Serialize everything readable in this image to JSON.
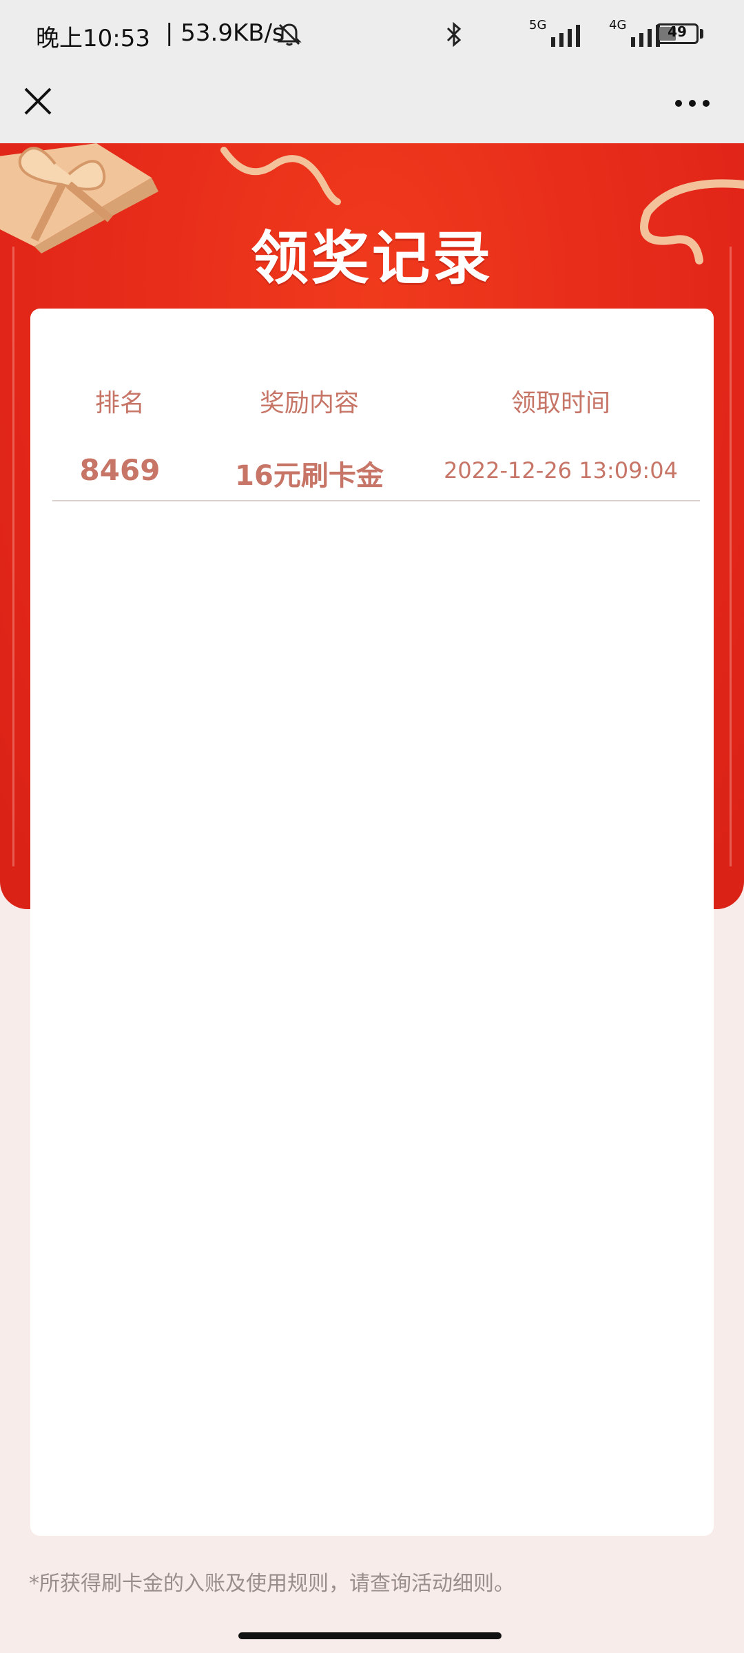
{
  "status_bar": {
    "time": "晚上10:53",
    "speed": "| 53.9KB/s",
    "net_5g": "5G",
    "net_4g": "4G",
    "battery": "49"
  },
  "header": {
    "title": "领奖记录"
  },
  "table": {
    "columns": [
      "排名",
      "奖励内容",
      "领取时间"
    ],
    "rows": [
      {
        "rank": "8469",
        "reward": "16元刷卡金",
        "time": "2022-12-26 13:09:04"
      }
    ]
  },
  "footer": {
    "note": "*所获得刷卡金的入账及使用规则，请查询活动细则。"
  },
  "colors": {
    "accent_red": "#e5291a",
    "text_pink": "#c67567",
    "page_bg": "#f8ecea"
  }
}
